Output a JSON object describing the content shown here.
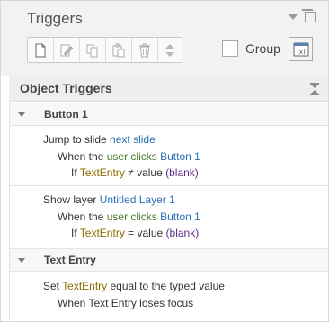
{
  "panel": {
    "title": "Triggers"
  },
  "toolbar": {
    "buttons": [
      {
        "icon": "new-trigger-icon"
      },
      {
        "icon": "edit-trigger-icon"
      },
      {
        "icon": "copy-icon"
      },
      {
        "icon": "paste-icon"
      },
      {
        "icon": "delete-icon"
      }
    ],
    "group_label": "Group"
  },
  "section": {
    "title": "Object Triggers"
  },
  "groups": [
    {
      "name": "Button 1",
      "triggers": [
        {
          "action_text": "Jump to slide",
          "action_target": "next slide",
          "when_prefix": "When the",
          "when_user": "user",
          "when_verb": "clicks",
          "when_object": "Button 1",
          "if_prefix": "If",
          "if_var": "TextEntry",
          "if_op": "≠ value",
          "if_value": "(blank)"
        },
        {
          "action_text": "Show layer",
          "action_target": "Untitled Layer 1",
          "when_prefix": "When the",
          "when_user": "user",
          "when_verb": "clicks",
          "when_object": "Button 1",
          "if_prefix": "If",
          "if_var": "TextEntry",
          "if_op": "= value",
          "if_value": "(blank)"
        }
      ]
    },
    {
      "name": "Text Entry",
      "triggers": [
        {
          "action_text": "Set",
          "action_var": "TextEntry",
          "action_rest": "equal to the typed value",
          "when_text": "When Text Entry loses focus"
        }
      ]
    }
  ],
  "colors": {
    "link_blue": "#2a6fb5",
    "variable_olive": "#8a6d00",
    "user_green": "#4a7a2a",
    "value_purple": "#5b2d86"
  }
}
